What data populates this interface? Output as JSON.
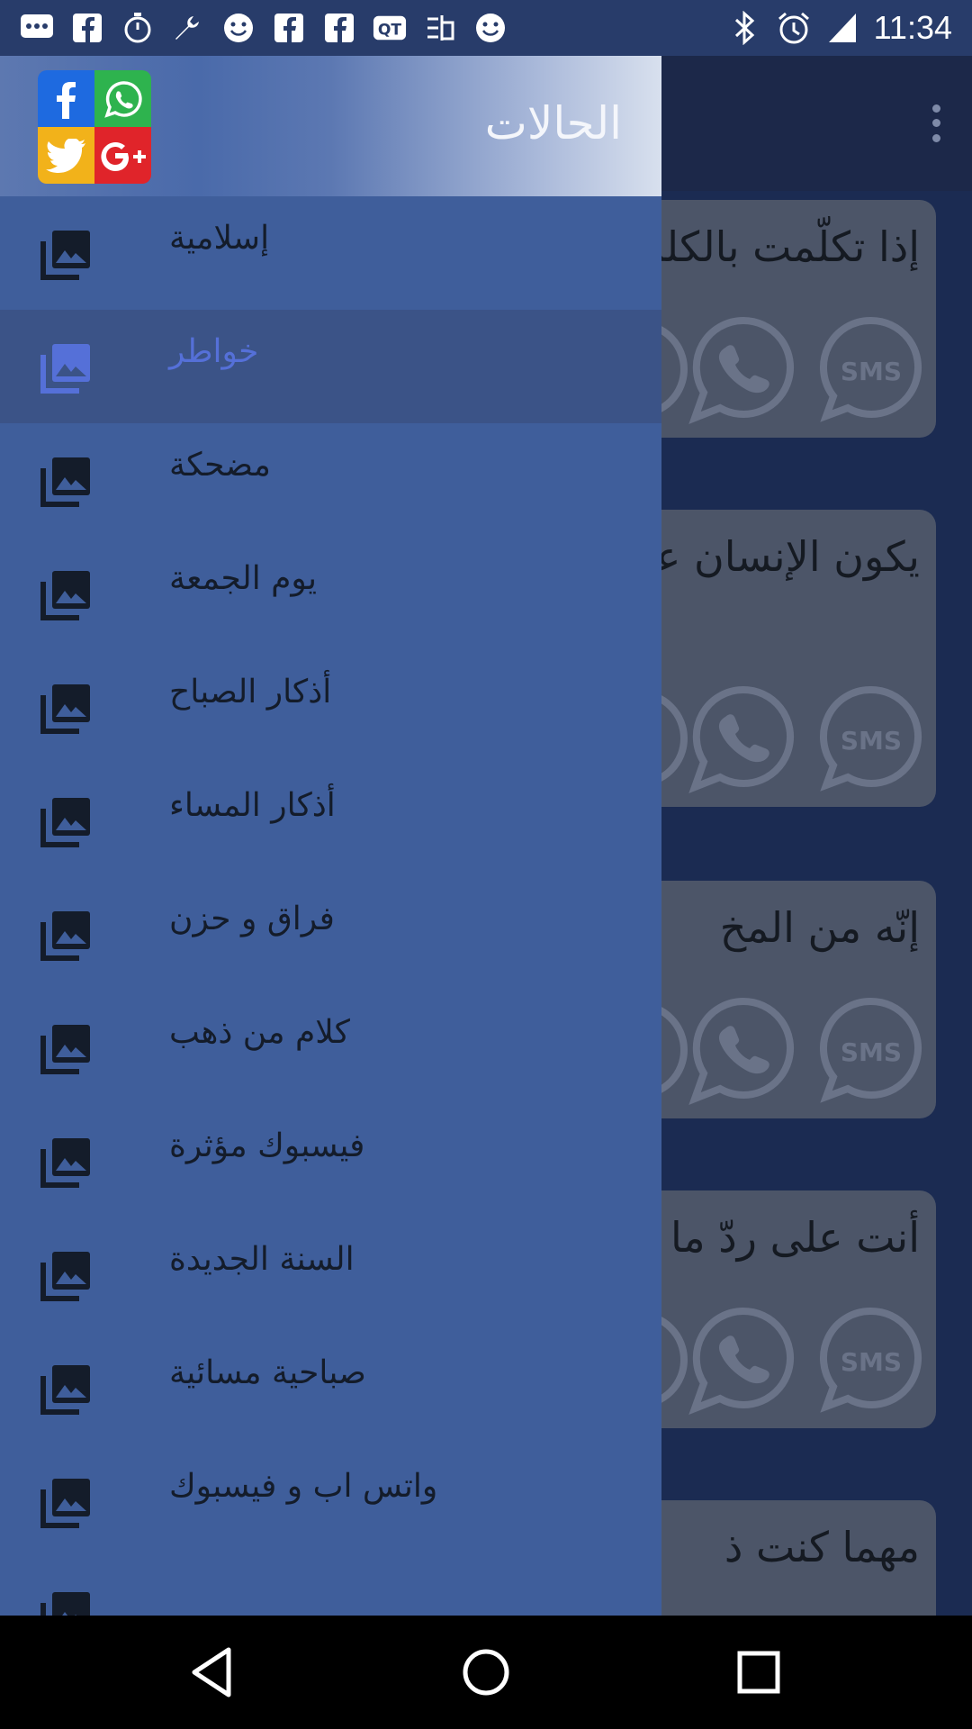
{
  "status_bar": {
    "time": "11:34",
    "left_icons": [
      "chat-icon",
      "facebook-icon",
      "timer-icon",
      "wrench-icon",
      "smiley-icon",
      "facebook-icon",
      "facebook-icon",
      "qt-icon",
      "app-icon",
      "smiley-icon"
    ],
    "right_icons": [
      "bluetooth-icon",
      "alarm-icon",
      "signal-icon"
    ]
  },
  "drawer": {
    "title": "الحالات",
    "logo_icons": [
      "facebook",
      "whatsapp",
      "twitter",
      "google-plus"
    ],
    "items": [
      {
        "label": "إسلامية"
      },
      {
        "label": "خواطر",
        "active": true
      },
      {
        "label": "مضحكة"
      },
      {
        "label": "يوم الجمعة"
      },
      {
        "label": "أذكار الصباح"
      },
      {
        "label": "أذكار المساء"
      },
      {
        "label": "فراق و حزن"
      },
      {
        "label": "كلام من ذهب"
      },
      {
        "label": "فيسبوك مؤثرة"
      },
      {
        "label": "السنة الجديدة"
      },
      {
        "label": "صباحية مسائية"
      },
      {
        "label": "واتس اب و فيسبوك"
      }
    ]
  },
  "cards": [
    {
      "text": "إذا تكلّمت بالكلمة"
    },
    {
      "text": "يكون الإنسان عبداً و"
    },
    {
      "text": "إنّه من المخ"
    },
    {
      "text": "أنت على ردّ ما"
    },
    {
      "text": "مهما كنت ذ"
    }
  ],
  "card_icon_labels": {
    "sms": "SMS"
  },
  "colors": {
    "drawer_bg": "#3f5e9b",
    "active_row": "#3b5387",
    "active_label": "#5570d8"
  },
  "nav_bar": {
    "icons": [
      "back-icon",
      "home-icon",
      "recents-icon"
    ]
  }
}
